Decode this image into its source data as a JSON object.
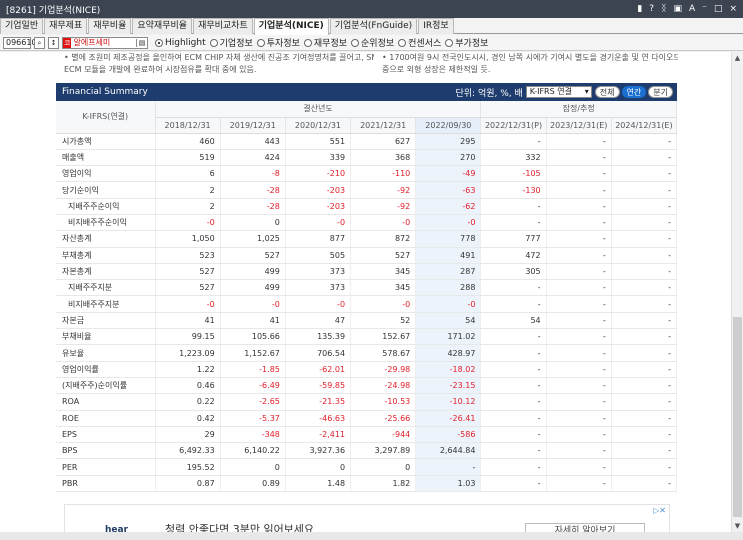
{
  "window": {
    "title": "[8261] 기업분석(NICE)",
    "controls": [
      "▮",
      "?",
      "ᛝ",
      "▣",
      "A",
      "⁻",
      "□",
      "×"
    ]
  },
  "tabs": [
    {
      "label": "기업일반",
      "active": false
    },
    {
      "label": "재무제표",
      "active": false
    },
    {
      "label": "재무비율",
      "active": false
    },
    {
      "label": "요약재무비율",
      "active": false
    },
    {
      "label": "재무비교차트",
      "active": false
    },
    {
      "label": "기업분석(NICE)",
      "active": true
    },
    {
      "label": "기업분석(FnGuide)",
      "active": false
    },
    {
      "label": "IR정보",
      "active": false
    }
  ],
  "toolbar": {
    "code": "096610",
    "name_mark": "코",
    "name": "알에프세미",
    "radios": [
      {
        "label": "Highlight",
        "on": true
      },
      {
        "label": "기업정보",
        "on": false
      },
      {
        "label": "투자정보",
        "on": false
      },
      {
        "label": "재무정보",
        "on": false
      },
      {
        "label": "순위정보",
        "on": false
      },
      {
        "label": "컨센서스",
        "on": false
      },
      {
        "label": "부가정보",
        "on": false
      }
    ]
  },
  "notes": {
    "left1": "• 별에 조원미 제조공정을 올인하여 ECM CHIP 자체 생산에 진공조 기여정명처를 끌어고, SMD가 가능한",
    "left2": "ECM 모듈을 개발에 완료하여 시장점유를 확대 중에 있음.",
    "right1": "• 1700여원 9시 전국인도시시, 경인 남쪽 시에가 기여시 별도을 경기운출 및 연 다이오드 인입서 무인",
    "right2": "중으로 외형 성장은 제한적일 듯."
  },
  "summary": {
    "title": "Financial Summary",
    "unit": "단위: 억원, %, 배",
    "select": "K-IFRS 연결",
    "buttons": [
      {
        "label": "전체",
        "on": false
      },
      {
        "label": "연간",
        "on": true
      },
      {
        "label": "분기",
        "on": false
      }
    ],
    "row_header": "K-IFRS(연결)",
    "group_actual": "결산년도",
    "group_forecast": "잠정/추정",
    "columns": [
      "2018/12/31",
      "2019/12/31",
      "2020/12/31",
      "2021/12/31",
      "2022/09/30",
      "2022/12/31(P)",
      "2023/12/31(E)",
      "2024/12/31(E)"
    ],
    "rows": [
      {
        "label": "시가총액",
        "sub": false,
        "values": [
          "460",
          "443",
          "551",
          "627",
          "295",
          "-",
          "-",
          "-"
        ]
      },
      {
        "label": "매출액",
        "sub": false,
        "values": [
          "519",
          "424",
          "339",
          "368",
          "270",
          "332",
          "-",
          "-"
        ]
      },
      {
        "label": "영업이익",
        "sub": false,
        "values": [
          "6",
          "-8",
          "-210",
          "-110",
          "-49",
          "-105",
          "-",
          "-"
        ]
      },
      {
        "label": "당기순이익",
        "sub": false,
        "values": [
          "2",
          "-28",
          "-203",
          "-92",
          "-63",
          "-130",
          "-",
          "-"
        ]
      },
      {
        "label": "지배주주순이익",
        "sub": true,
        "values": [
          "2",
          "-28",
          "-203",
          "-92",
          "-62",
          "-",
          "-",
          "-"
        ]
      },
      {
        "label": "비지배주주순이익",
        "sub": true,
        "values": [
          "-0",
          "0",
          "-0",
          "-0",
          "-0",
          "-",
          "-",
          "-"
        ]
      },
      {
        "label": "자산총계",
        "sub": false,
        "values": [
          "1,050",
          "1,025",
          "877",
          "872",
          "778",
          "777",
          "-",
          "-"
        ]
      },
      {
        "label": "부채총계",
        "sub": false,
        "values": [
          "523",
          "527",
          "505",
          "527",
          "491",
          "472",
          "-",
          "-"
        ]
      },
      {
        "label": "자본총계",
        "sub": false,
        "values": [
          "527",
          "499",
          "373",
          "345",
          "287",
          "305",
          "-",
          "-"
        ]
      },
      {
        "label": "지배주주지분",
        "sub": true,
        "values": [
          "527",
          "499",
          "373",
          "345",
          "288",
          "-",
          "-",
          "-"
        ]
      },
      {
        "label": "비지배주주지분",
        "sub": true,
        "values": [
          "-0",
          "-0",
          "-0",
          "-0",
          "-0",
          "-",
          "-",
          "-"
        ]
      },
      {
        "label": "자본금",
        "sub": false,
        "values": [
          "41",
          "41",
          "47",
          "52",
          "54",
          "54",
          "-",
          "-"
        ]
      },
      {
        "label": "부채비율",
        "sub": false,
        "values": [
          "99.15",
          "105.66",
          "135.39",
          "152.67",
          "171.02",
          "-",
          "-",
          "-"
        ]
      },
      {
        "label": "유보율",
        "sub": false,
        "values": [
          "1,223.09",
          "1,152.67",
          "706.54",
          "578.67",
          "428.97",
          "-",
          "-",
          "-"
        ]
      },
      {
        "label": "영업이익률",
        "sub": false,
        "values": [
          "1.22",
          "-1.85",
          "-62.01",
          "-29.98",
          "-18.02",
          "-",
          "-",
          "-"
        ]
      },
      {
        "label": "(지배주주)순이익률",
        "sub": false,
        "values": [
          "0.46",
          "-6.49",
          "-59.85",
          "-24.98",
          "-23.15",
          "-",
          "-",
          "-"
        ]
      },
      {
        "label": "ROA",
        "sub": false,
        "values": [
          "0.22",
          "-2.65",
          "-21.35",
          "-10.53",
          "-10.12",
          "-",
          "-",
          "-"
        ]
      },
      {
        "label": "ROE",
        "sub": false,
        "values": [
          "0.42",
          "-5.37",
          "-46.63",
          "-25.66",
          "-26.41",
          "-",
          "-",
          "-"
        ]
      },
      {
        "label": "EPS",
        "sub": false,
        "values": [
          "29",
          "-348",
          "-2,411",
          "-944",
          "-586",
          "-",
          "-",
          "-"
        ]
      },
      {
        "label": "BPS",
        "sub": false,
        "values": [
          "6,492.33",
          "6,140.22",
          "3,927.36",
          "3,297.89",
          "2,644.84",
          "-",
          "-",
          "-"
        ]
      },
      {
        "label": "PER",
        "sub": false,
        "values": [
          "195.52",
          "0",
          "0",
          "0",
          "-",
          "-",
          "-",
          "-"
        ]
      },
      {
        "label": "PBR",
        "sub": false,
        "values": [
          "0.87",
          "0.89",
          "1.48",
          "1.82",
          "1.03",
          "-",
          "-",
          "-"
        ]
      }
    ]
  },
  "ad": {
    "logo": "hear",
    "text": "청력 안좋다면 3분만 읽어보세요",
    "button": "자세히 알아보기",
    "close": "▷✕"
  },
  "colors": {
    "header_bg": "#1e3d6e",
    "negative": "#e0202a",
    "highlight_col": "#edf3fb",
    "accent": "#1a6fd1"
  }
}
